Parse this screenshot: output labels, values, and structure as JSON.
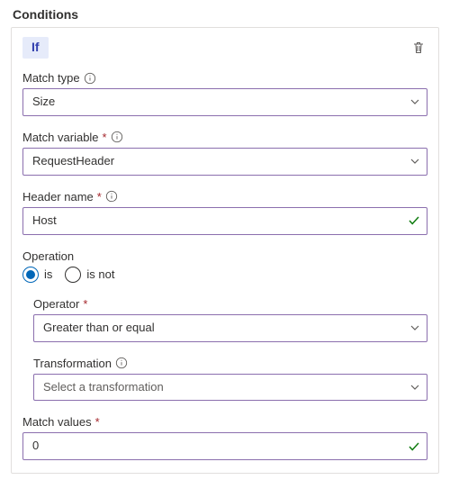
{
  "section_title": "Conditions",
  "condition_badge": "If",
  "fields": {
    "match_type": {
      "label": "Match type",
      "required": false,
      "info": true,
      "value": "Size"
    },
    "match_variable": {
      "label": "Match variable",
      "required": true,
      "info": true,
      "value": "RequestHeader"
    },
    "header_name": {
      "label": "Header name",
      "required": true,
      "info": true,
      "value": "Host",
      "valid": true
    },
    "operation": {
      "label": "Operation",
      "options": {
        "is": "is",
        "is_not": "is not"
      },
      "selected": "is"
    },
    "operator": {
      "label": "Operator",
      "required": true,
      "info": false,
      "value": "Greater than or equal"
    },
    "transformation": {
      "label": "Transformation",
      "required": false,
      "info": true,
      "placeholder": "Select a transformation",
      "value": ""
    },
    "match_values": {
      "label": "Match values",
      "required": true,
      "info": false,
      "value": "0",
      "valid": true
    }
  }
}
